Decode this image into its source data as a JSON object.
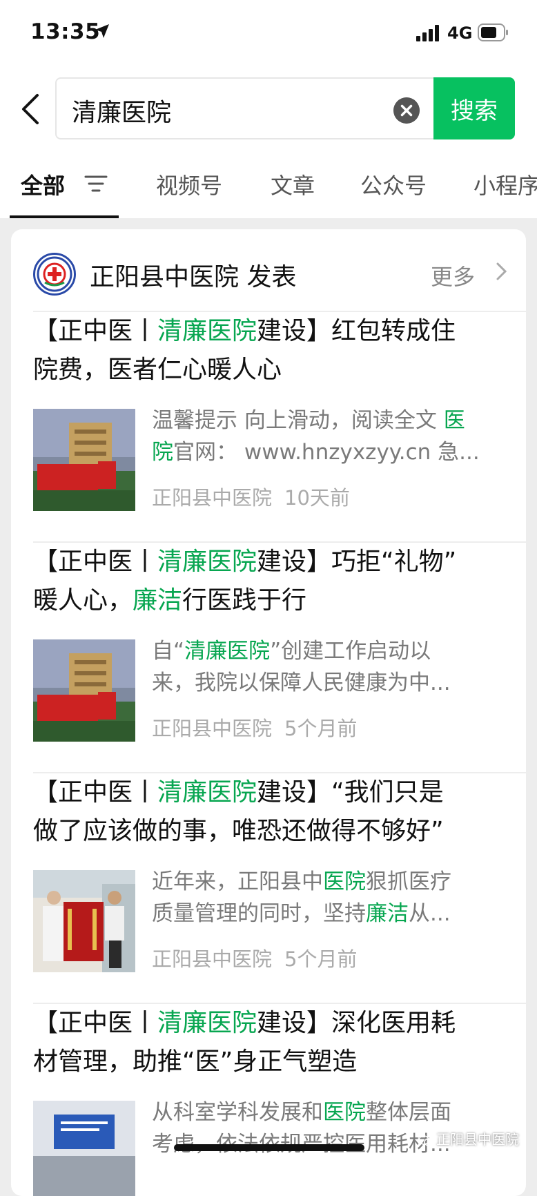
{
  "status": {
    "time": "13:35",
    "network": "4G",
    "icons": [
      "location-arrow-icon",
      "signal-icon",
      "battery-icon"
    ]
  },
  "search": {
    "query": "清廉医院",
    "button_label": "搜索"
  },
  "tabs": [
    {
      "label": "全部",
      "active": true
    },
    {
      "label": "视频号",
      "active": false
    },
    {
      "label": "文章",
      "active": false
    },
    {
      "label": "公众号",
      "active": false
    },
    {
      "label": "小程序",
      "active": false
    }
  ],
  "account": {
    "name_line": "正阳县中医院 发表",
    "more_label": "更多"
  },
  "articles": [
    {
      "title_parts": [
        [
          "【正中医丨",
          false
        ],
        [
          "清廉医院",
          true
        ],
        [
          "建设】红包转成住",
          false
        ]
      ],
      "title_line2": [
        [
          "院费，医者仁心暖人心",
          false
        ]
      ],
      "snip1": [
        [
          "温馨提示 向上滑动，阅读全文 ",
          false
        ],
        [
          "医",
          true
        ]
      ],
      "snip2": [
        [
          "院",
          true
        ],
        [
          "官网：  www.hnzyxzyy.cn 急...",
          false
        ]
      ],
      "source": "正阳县中医院",
      "time": "10天前"
    },
    {
      "title_parts": [
        [
          "【正中医丨",
          false
        ],
        [
          "清廉医院",
          true
        ],
        [
          "建设】巧拒“礼物”",
          false
        ]
      ],
      "title_line2": [
        [
          "暖人心，",
          false
        ],
        [
          "廉洁",
          true
        ],
        [
          "行医践于行",
          false
        ]
      ],
      "snip1": [
        [
          "自“",
          false
        ],
        [
          "清廉医院",
          true
        ],
        [
          "”创建工作启动以",
          false
        ]
      ],
      "snip2": [
        [
          "来，我院以保障人民健康为中...",
          false
        ]
      ],
      "source": "正阳县中医院",
      "time": "5个月前"
    },
    {
      "title_parts": [
        [
          "【正中医丨",
          false
        ],
        [
          "清廉医院",
          true
        ],
        [
          "建设】“我们只是",
          false
        ]
      ],
      "title_line2": [
        [
          "做了应该做的事，唯恐还做得不够好”",
          false
        ]
      ],
      "snip1": [
        [
          "近年来，正阳县中",
          false
        ],
        [
          "医院",
          true
        ],
        [
          "狠抓医疗",
          false
        ]
      ],
      "snip2": [
        [
          "质量管理的同时，坚持",
          false
        ],
        [
          "廉洁",
          true
        ],
        [
          "从...",
          false
        ]
      ],
      "source": "正阳县中医院",
      "time": "5个月前"
    },
    {
      "title_parts": [
        [
          "【正中医丨",
          false
        ],
        [
          "清廉医院",
          true
        ],
        [
          "建设】深化医用耗",
          false
        ]
      ],
      "title_line2": [
        [
          "材管理，助推“医”身正气塑造",
          false
        ]
      ],
      "snip1": [
        [
          "从科室学科发展和",
          false
        ],
        [
          "医院",
          true
        ],
        [
          "整体层面",
          false
        ]
      ],
      "snip2": [
        [
          "考虑，依法依规严控医用耗材...",
          false
        ]
      ],
      "source": "",
      "time": ""
    }
  ],
  "watermark": "正阳县中医院",
  "colors": {
    "accent": "#07c160",
    "highlight": "#07a650",
    "background": "#ededed"
  }
}
